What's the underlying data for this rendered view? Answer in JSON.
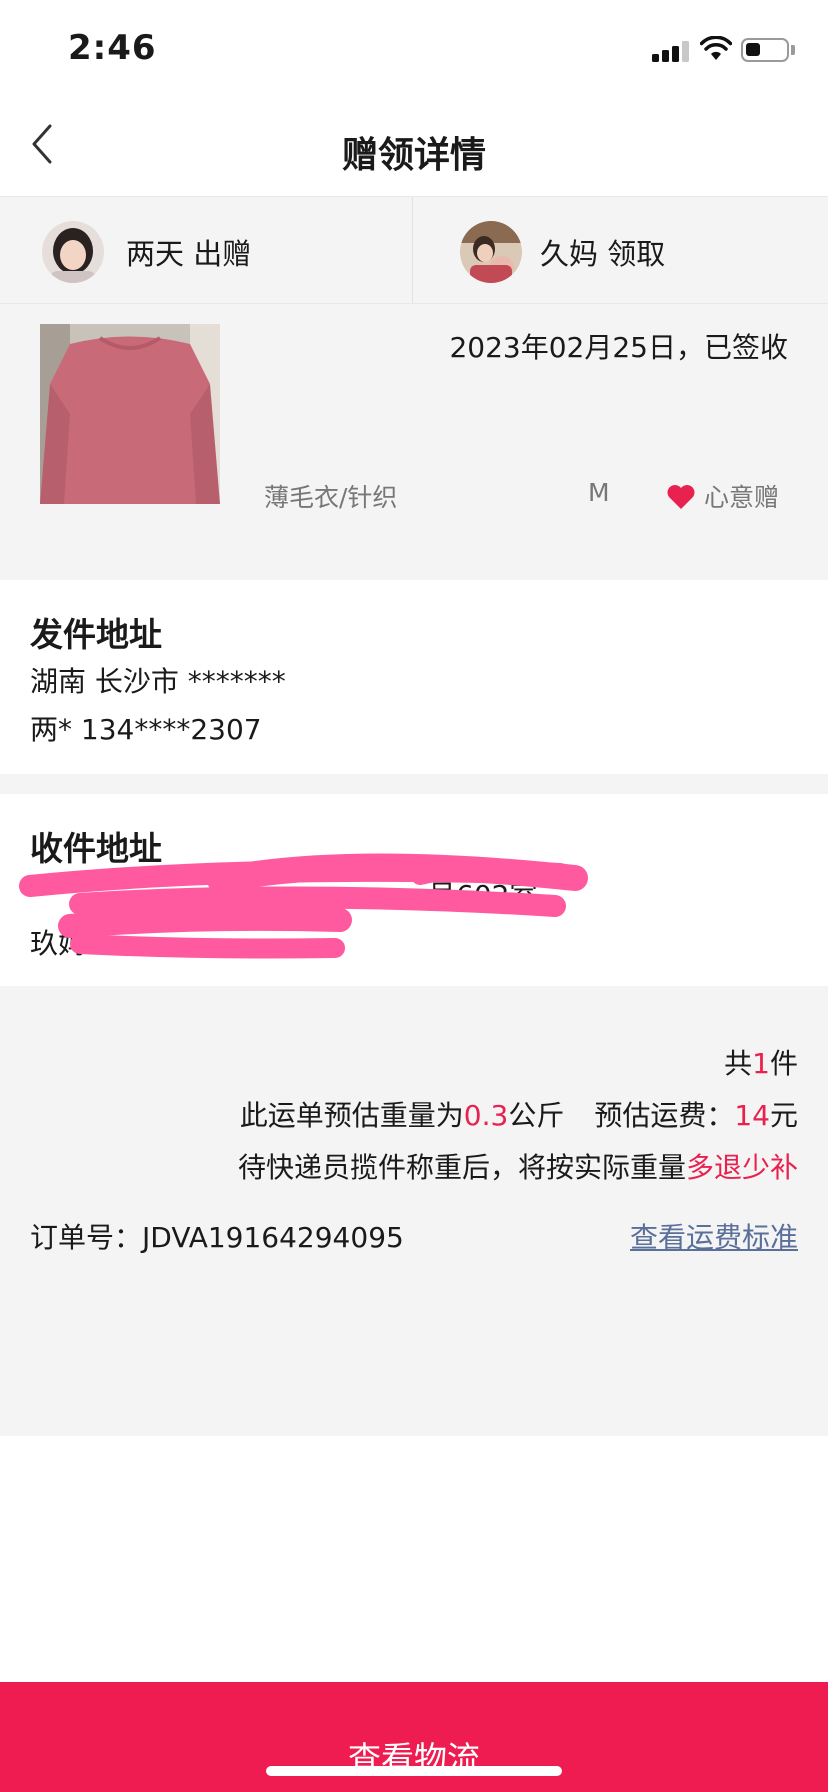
{
  "status_bar": {
    "time": "2:46"
  },
  "nav": {
    "title": "赠领详情",
    "back_icon": "chevron-left-icon"
  },
  "parties": {
    "giver": {
      "name": "两天 出赠"
    },
    "receiver": {
      "name": "久妈 领取"
    }
  },
  "item": {
    "date_status": "2023年02月25日，已签收",
    "category": "薄毛衣/针织",
    "size": "M",
    "gift_type": "心意赠",
    "heart_color": "#e8214f"
  },
  "sender_address": {
    "title": "发件地址",
    "line1": "湖南 长沙市 *******",
    "line2": "两* 134****2307"
  },
  "receiver_address": {
    "title": "收件地址",
    "line1_visible": "号602室",
    "line2_visible": "玖妈"
  },
  "summary": {
    "count_prefix": "共",
    "count_value": "1",
    "count_suffix": "件",
    "weight_prefix": "此运单预估重量为",
    "weight_value": "0.3",
    "weight_unit": "公斤",
    "fee_label": "预估运费：",
    "fee_value": "14",
    "fee_unit": "元",
    "refund_prefix": "待快递员揽件称重后，将按实际重量",
    "refund_highlight": "多退少补",
    "order_label": "订单号：",
    "order_number": "JDVA19164294095",
    "fee_standard_link": "查看运费标准"
  },
  "footer": {
    "button_label": "查看物流"
  },
  "colors": {
    "accent": "#ee1c50",
    "highlight": "#e8214f",
    "link": "#5a6f9a",
    "scribble": "#ff5aa0"
  }
}
